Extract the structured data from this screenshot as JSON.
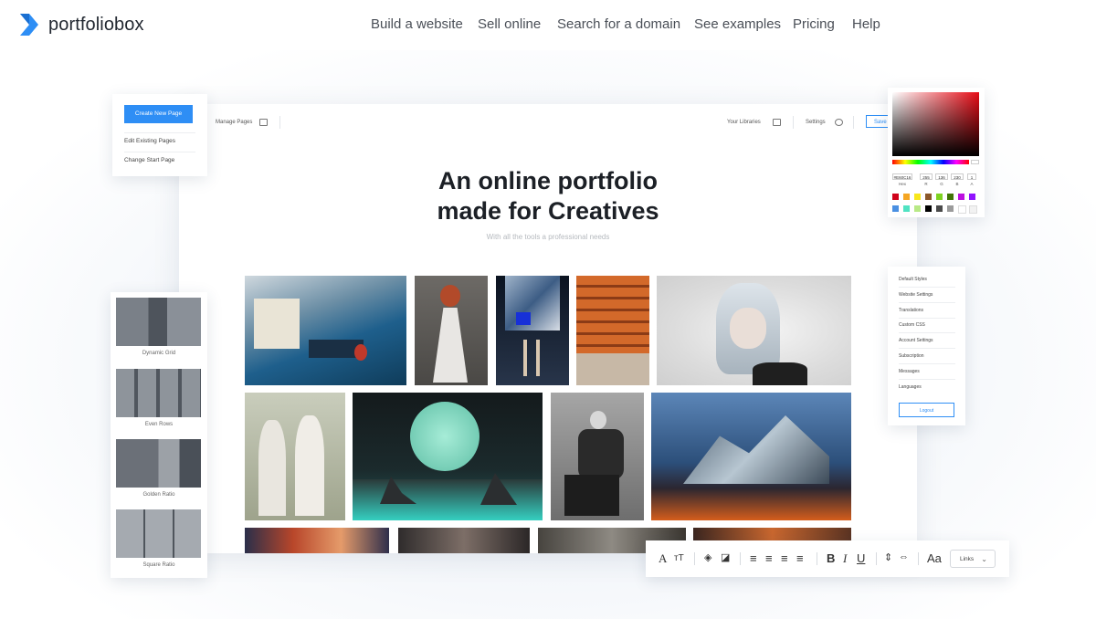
{
  "brand": {
    "name": "portfoliobox",
    "logo_color": "#2e8ef5"
  },
  "nav": {
    "links": [
      "Build a website",
      "Sell online",
      "Search for a domain",
      "See examples",
      "Pricing",
      "Help"
    ]
  },
  "editor": {
    "manage_pages": "Manage Pages",
    "your_libraries": "Your Libraries",
    "settings": "Settings",
    "save": "Save",
    "hero_title_line1": "An online portfolio",
    "hero_title_line2": "made for Creatives",
    "hero_subtitle": "With all the tools a professional needs"
  },
  "pages_menu": {
    "create_button": "Create New Page",
    "items": [
      "Edit Existing Pages",
      "Change Start Page"
    ]
  },
  "layouts": {
    "items": [
      "Dynamic Grid",
      "Even Rows",
      "Golden Ratio",
      "Square Ratio"
    ]
  },
  "color_picker": {
    "hex": "#E60C16",
    "r": "255",
    "g": "136",
    "b": "230",
    "a": "1",
    "labels": [
      "Hex",
      "R",
      "G",
      "B",
      "A"
    ],
    "swatches": [
      "#d0021b",
      "#f5a623",
      "#f8e71c",
      "#8b572a",
      "#7ed321",
      "#417505",
      "#bd10e0",
      "#9013fe",
      "#4a90e2",
      "#50e3c2",
      "#b8e986",
      "#000000",
      "#4a4a4a",
      "#9b9b9b",
      "#ffffff",
      "#f2f2f2"
    ]
  },
  "settings_menu": {
    "items": [
      "Default Styles",
      "Website Settings",
      "Translations",
      "Custom CSS",
      "Account Settings",
      "Subscription",
      "Messages",
      "Languages"
    ],
    "logout": "Logout"
  },
  "text_toolbar": {
    "bold": "B",
    "italic": "I",
    "underline": "U",
    "font": "Aa",
    "links_select": "Links"
  },
  "accent_color": "#2e8ef5"
}
